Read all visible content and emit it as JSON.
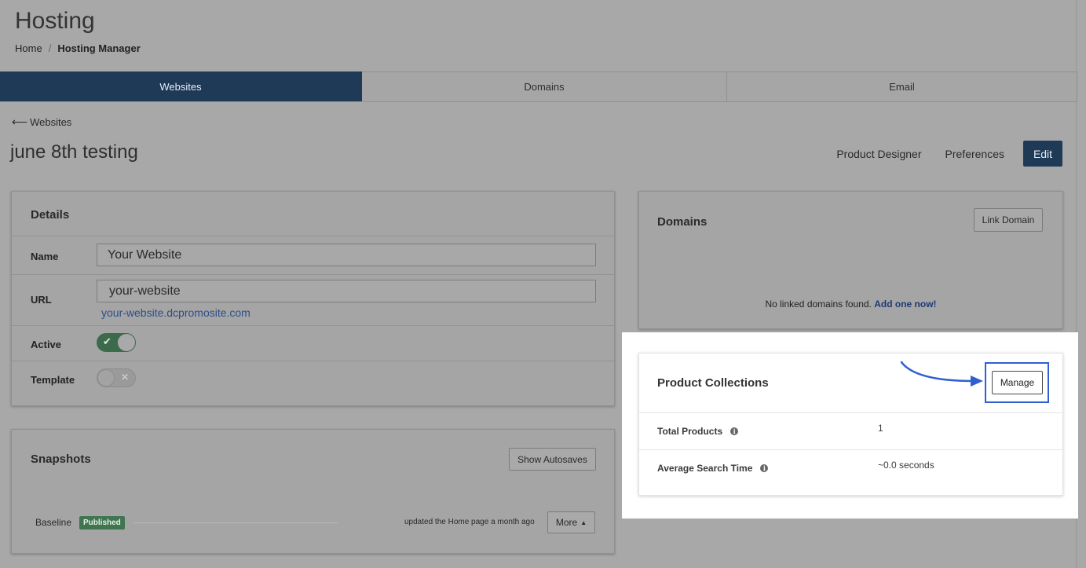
{
  "header": {
    "title": "Hosting",
    "breadcrumb": {
      "home": "Home",
      "separator": "/",
      "current": "Hosting Manager"
    }
  },
  "tabs": [
    {
      "label": "Websites",
      "active": true
    },
    {
      "label": "Domains",
      "active": false
    },
    {
      "label": "Email",
      "active": false
    }
  ],
  "back_link": {
    "icon": "arrow-left-icon",
    "label": "Websites"
  },
  "site_title": "june 8th testing",
  "actions": {
    "product_designer": "Product Designer",
    "preferences": "Preferences",
    "edit": "Edit"
  },
  "details": {
    "title": "Details",
    "name_label": "Name",
    "name_value": "Your Website",
    "url_label": "URL",
    "url_value": "your-website",
    "url_link": "your-website.dcpromosite.com",
    "active_label": "Active",
    "active_on": true,
    "template_label": "Template",
    "template_on": false
  },
  "snapshots": {
    "title": "Snapshots",
    "show_autosaves": "Show Autosaves",
    "row": {
      "name": "Baseline",
      "status": "Published",
      "updated": "updated the Home page a month ago",
      "more": "More"
    }
  },
  "domains": {
    "title": "Domains",
    "link_button": "Link Domain",
    "empty_text": "No linked domains found.",
    "add_link": "Add one now!"
  },
  "product_collections": {
    "title": "Product Collections",
    "manage_button": "Manage",
    "rows": [
      {
        "label": "Total Products",
        "value": "1"
      },
      {
        "label": "Average Search Time",
        "value": "~0.0 seconds"
      }
    ]
  },
  "colors": {
    "nav_active": "#1f3a57",
    "highlight_blue": "#2f5fd0",
    "published_green": "#3f7550"
  }
}
